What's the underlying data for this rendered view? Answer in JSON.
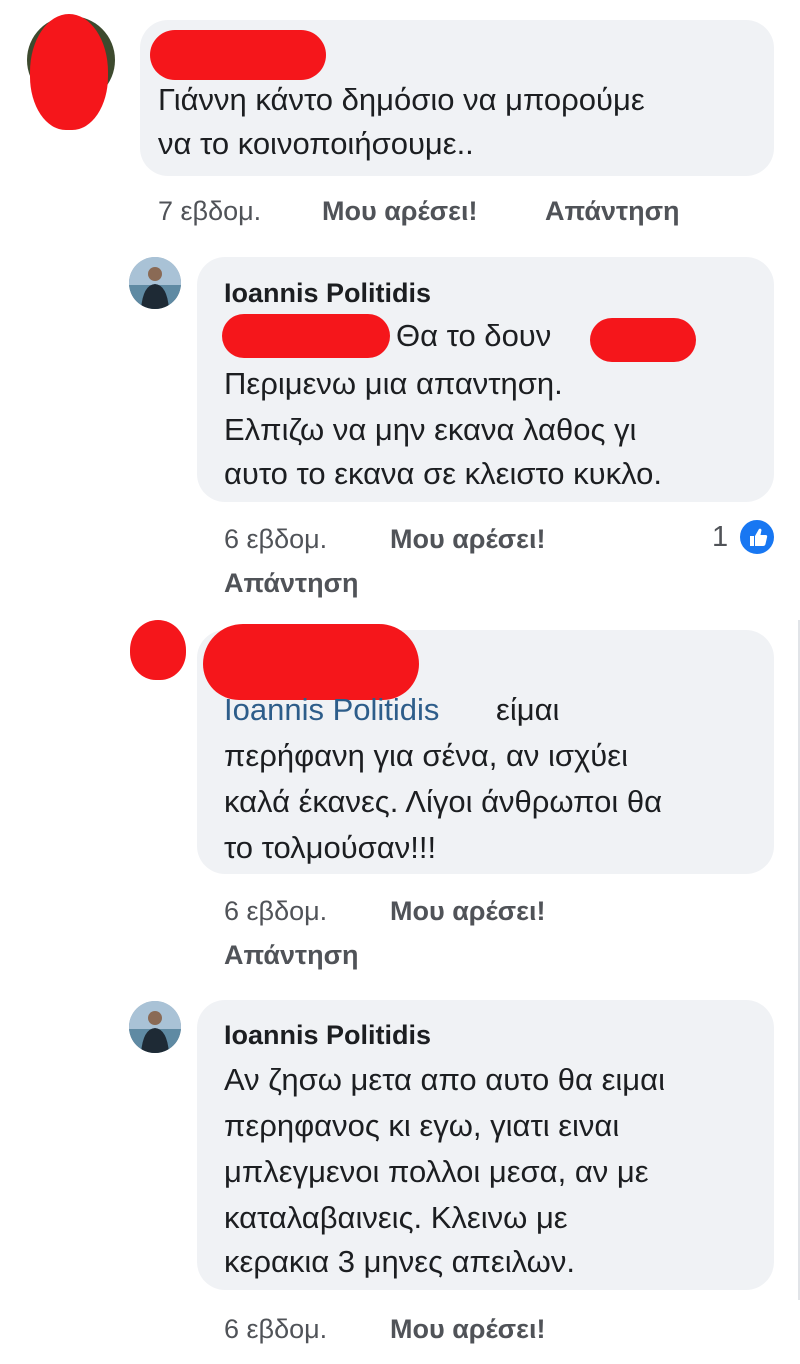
{
  "comments": [
    {
      "author": "",
      "text_lines": [
        "Γιάννη κάντο δημόσιο να μπορούμε",
        "να το κοινοποιήσουμε.."
      ],
      "time": "7 εβδομ.",
      "like_label": "Μου αρέσει!",
      "reply_label": "Απάντηση"
    },
    {
      "author": "Ioannis Politidis",
      "text_lines": [
        "Θα το δουν",
        "Περιμενω μια απαντηση.",
        "Ελπιζω να μην εκανα λαθος γι",
        "αυτο το εκανα σε κλειστο κυκλο."
      ],
      "time": "6 εβδομ.",
      "like_label": "Μου αρέσει!",
      "reply_label": "Απάντηση",
      "reaction_count": "1"
    },
    {
      "author": "",
      "mention": "Ioannis Politidis",
      "text_lines": [
        "είμαι",
        "περήφανη για σένα, αν ισχύει",
        "καλά έκανες. Λίγοι άνθρωποι θα",
        "το τολμούσαν!!!"
      ],
      "time": "6 εβδομ.",
      "like_label": "Μου αρέσει!",
      "reply_label": "Απάντηση"
    },
    {
      "author": "Ioannis Politidis",
      "text_lines": [
        "Αν ζησω μετα απο αυτο θα ειμαι",
        "περηφανος κι εγω, γιατι ειναι",
        "μπλεγμενοι πολλοι μεσα, αν με",
        "καταλαβαινεις. Κλεινω με",
        "κερακια 3 μηνες απειλων."
      ],
      "time": "6 εβδομ.",
      "like_label": "Μου αρέσει!"
    }
  ],
  "colors": {
    "bubble": "#f0f2f5",
    "redaction": "#f5161b",
    "like_blue": "#1877f2",
    "mention": "#2d5d8a"
  },
  "icons": [
    "avatar",
    "thumbs-up-icon"
  ]
}
